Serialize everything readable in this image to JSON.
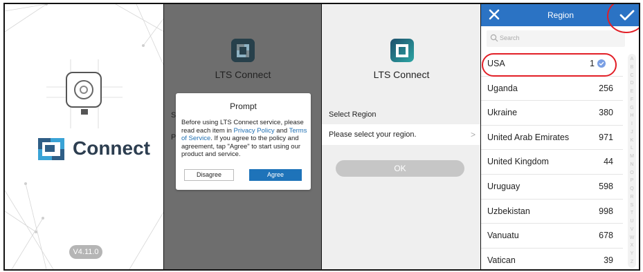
{
  "splash": {
    "brand_name": "Connect",
    "version": "V4.11.0",
    "icons": {
      "camera": "camera-icon",
      "logo": "lts-logo-icon"
    }
  },
  "prompt_screen": {
    "app_name": "LTS Connect",
    "peek_1": "S",
    "peek_2": "P",
    "dialog": {
      "title": "Prompt",
      "text_1": "Before using LTS Connect service, please read each item in ",
      "privacy_link": "Privacy Policy",
      "text_2": " and ",
      "terms_link": "Terms of Service",
      "text_3": ". If you agree to the policy and agreement, tap \"Agree\" to start using our product and service.",
      "disagree_label": "Disagree",
      "agree_label": "Agree"
    }
  },
  "select_screen": {
    "app_name": "LTS Connect",
    "section_label": "Select Region",
    "row_placeholder": "Please select your region.",
    "chevron": ">",
    "ok_label": "OK"
  },
  "region_screen": {
    "title": "Region",
    "search_placeholder": "Search",
    "rows": [
      {
        "name": "USA",
        "code": "1",
        "selected": true
      },
      {
        "name": "Uganda",
        "code": "256"
      },
      {
        "name": "Ukraine",
        "code": "380"
      },
      {
        "name": "United Arab Emirates",
        "code": "971"
      },
      {
        "name": "United Kingdom",
        "code": "44"
      },
      {
        "name": "Uruguay",
        "code": "598"
      },
      {
        "name": "Uzbekistan",
        "code": "998"
      },
      {
        "name": "Vanuatu",
        "code": "678"
      },
      {
        "name": "Vatican",
        "code": "39"
      }
    ],
    "alphabet": [
      "A",
      "B",
      "C",
      "D",
      "E",
      "F",
      "G",
      "H",
      "I",
      "J",
      "K",
      "L",
      "M",
      "N",
      "O",
      "P",
      "Q",
      "R",
      "S",
      "T",
      "U",
      "V",
      "W",
      "X",
      "Y",
      "Z"
    ]
  },
  "colors": {
    "header_blue": "#2b73c4",
    "agree_blue": "#1e73b9",
    "annotation_red": "#e21e26",
    "brand_dark": "#2d3e50",
    "dim_overlay": "#6e6e6e"
  }
}
